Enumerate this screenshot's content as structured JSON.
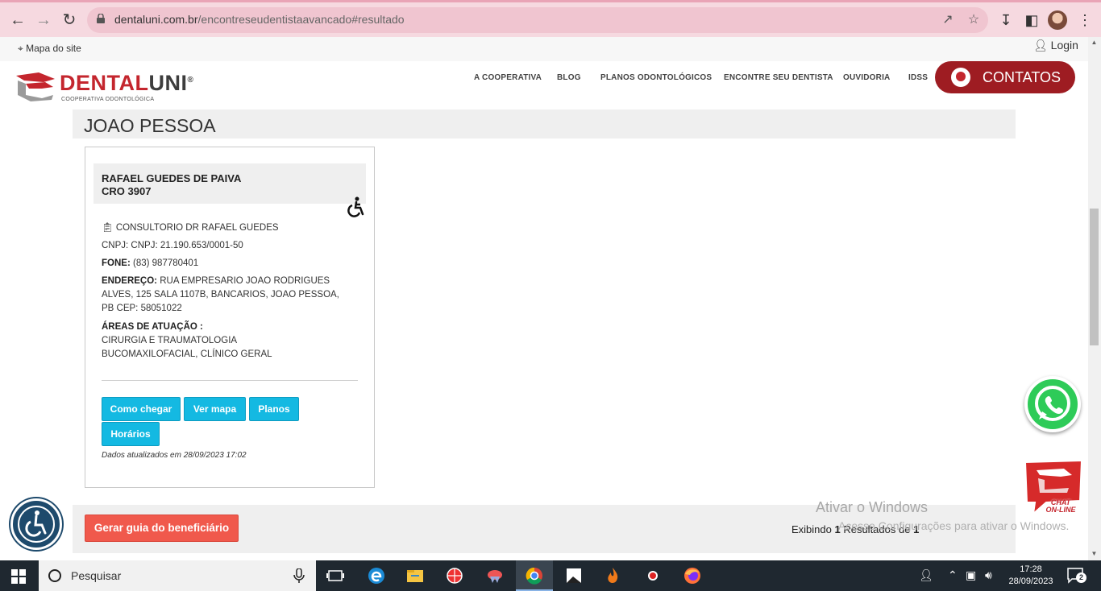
{
  "browser": {
    "url_domain": "dentaluni.com.br",
    "url_path": "/encontreseudentistaavancado#resultado"
  },
  "utility": {
    "sitemap": "Mapa do site",
    "login": "Login"
  },
  "header": {
    "brand_red": "DENTAL",
    "brand_gray": "UNI",
    "brand_reg": "®",
    "subtitle": "COOPERATIVA ODONTOLÓGICA",
    "menu": [
      "A COOPERATIVA",
      "BLOG",
      "PLANOS ODONTOLÓGICOS",
      "ENCONTRE SEU DENTISTA",
      "OUVIDORIA",
      "IDSS"
    ],
    "contatos": "CONTATOS"
  },
  "city": "JOAO PESSOA",
  "dentist": {
    "name": "RAFAEL GUEDES DE PAIVA",
    "cro": "CRO 3907",
    "clinic": "CONSULTORIO DR RAFAEL GUEDES",
    "cnpj": "CNPJ: CNPJ: 21.190.653/0001-50",
    "fone_label": "FONE:",
    "fone": "(83) 987780401",
    "endereco_label": "ENDEREÇO:",
    "endereco": "RUA EMPRESARIO JOAO RODRIGUES ALVES, 125 SALA 1107B, BANCARIOS, JOAO PESSOA, PB CEP: 58051022",
    "areas_label": "ÁREAS DE ATUAÇÃO :",
    "areas": "CIRURGIA E TRAUMATOLOGIA BUCOMAXILOFACIAL, CLÍNICO GERAL",
    "buttons": {
      "como_chegar": "Como chegar",
      "ver_mapa": "Ver mapa",
      "planos": "Planos",
      "horarios": "Horários"
    },
    "updated": "Dados atualizados em 28/09/2023 17:02"
  },
  "footer": {
    "guia": "Gerar guia do beneficiário",
    "exibindo_pre": "Exibindo ",
    "exibindo_n": "1",
    "exibindo_mid": " Resultados de ",
    "exibindo_total": "1"
  },
  "chat": {
    "line1": "CHAT",
    "line2": "ON-LINE"
  },
  "watermark": {
    "title": "Ativar o Windows",
    "subtitle": "Acesse Configurações para ativar o Windows."
  },
  "taskbar": {
    "search_placeholder": "Pesquisar",
    "time": "17:28",
    "date": "28/09/2023",
    "notifications": "2"
  },
  "colors": {
    "brand_red": "#c4262e",
    "contatos_bg": "#9e1c22",
    "button_blue": "#14b9e2",
    "guia_red": "#f0594c",
    "whatsapp": "#2ecb58"
  }
}
